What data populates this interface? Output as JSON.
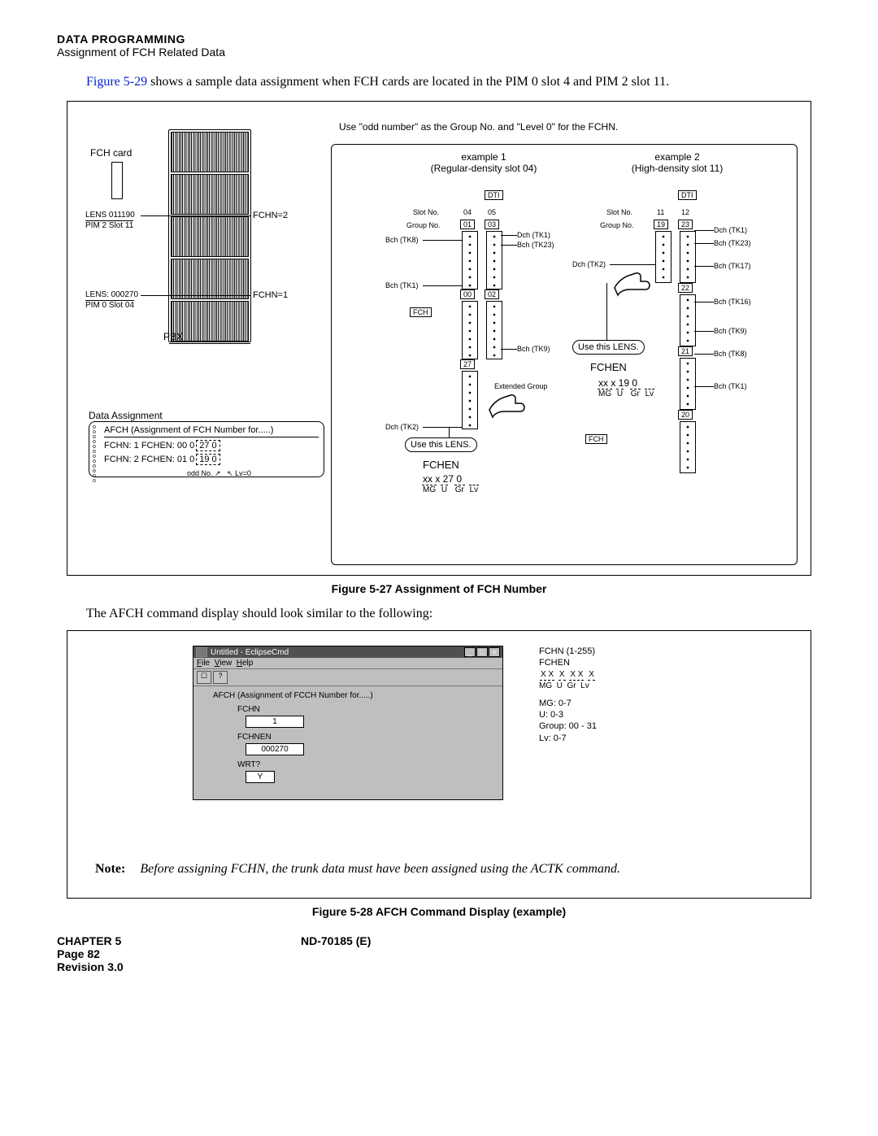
{
  "header": {
    "title": "Data Programming",
    "subtitle": "Assignment of FCH Related Data"
  },
  "intro": {
    "link_text": "Figure 5-29",
    "rest": " shows a sample data assignment when FCH cards are located in the PIM 0 slot 4 and PIM 2 slot 11."
  },
  "fig27": {
    "instruction": "Use \"odd number\" as the Group No. and \"Level 0\" for the FCHN.",
    "fch_card": "FCH card",
    "lens1": "LENS 011190",
    "pim1": "PIM 2 Slot 11",
    "fchn_a": "FCHN=2",
    "lens2": "LENS: 000270",
    "pim2": "PIM 0 Slot 04",
    "fchn_b": "FCHN=1",
    "pbx": "PBX",
    "da_title": "Data Assignment",
    "da_head": "AFCH (Assignment of FCH Number for.....)",
    "da_row1_a": "FCHN: 1 FCHEN: 00 0",
    "da_row1_b": "27 0",
    "da_row2_a": "FCHN: 2 FCHEN: 01 0",
    "da_row2_b": "19 0",
    "da_odd": "odd No.",
    "da_lv": "Lv=0",
    "ex1_t": "example 1",
    "ex1_s": "(Regular-density slot 04)",
    "ex2_t": "example  2",
    "ex2_s": "(High-density slot 11)",
    "slotno": "Slot No.",
    "groupno": "Group No.",
    "bch_tk8": "Bch (TK8)",
    "bch_tk1": "Bch (TK1)",
    "dch_tk1": "Dch (TK1)",
    "bch_tk23": "Bch (TK23)",
    "bch_tk9": "Bch (TK9)",
    "bch_tk16": "Bch (TK16)",
    "bch_tk17": "Bch (TK17)",
    "dch_tk2": "Dch (TK2)",
    "ext_grp": "Extended Group",
    "use_lens": "Use this LENS.",
    "fchen": "FCHEN",
    "formula_a": "xx x 27 0",
    "formula_b": "xx x 19 0",
    "mg": "MG",
    "u": "U",
    "gr": "Gr",
    "lv": "Lv",
    "dti": "DTI",
    "fch": "FCH",
    "s04": "04",
    "s05": "05",
    "g01": "01",
    "g03": "03",
    "g00": "00",
    "g02": "02",
    "g27": "27",
    "s11": "11",
    "s12": "12",
    "g19": "19",
    "g23": "23",
    "g22": "22",
    "g21": "21",
    "g20": "20",
    "caption": "Figure 5-27   Assignment of FCH Number"
  },
  "mid_text": "The AFCH command display should look similar to the following:",
  "fig28": {
    "win_title": "Untitled - EclipseCmd",
    "m_file": "File",
    "m_view": "View",
    "m_help": "Help",
    "body_head": "AFCH (Assignment of FCCH Number for.....)",
    "f1_lab": "FCHN",
    "f1_val": "1",
    "f2_lab": "FCHNEN",
    "f2_val": "000270",
    "f3_lab": "WRT?",
    "f3_val": "Y",
    "legend_a": "FCHN (1-255)",
    "legend_b": "FCHEN",
    "legend_c_1": "X X",
    "legend_c_2": "X",
    "legend_c_3": "X X",
    "legend_c_4": "X",
    "legend_mg": "MG",
    "legend_u": "U",
    "legend_gr": "Gr",
    "legend_lv": "Lv",
    "legend_r1": "MG: 0-7",
    "legend_r2": "U: 0-3",
    "legend_r3": "Group: 00 - 31",
    "legend_r4": "Lv: 0-7",
    "caption": "Figure 5-28   AFCH Command Display (example)"
  },
  "note": {
    "label": "Note:",
    "body": "Before assigning FCHN, the trunk data must have been assigned using the ACTK command."
  },
  "footer": {
    "chapter": "CHAPTER 5",
    "doc": "ND-70185 (E)",
    "page": "Page 82",
    "rev": "Revision 3.0"
  }
}
